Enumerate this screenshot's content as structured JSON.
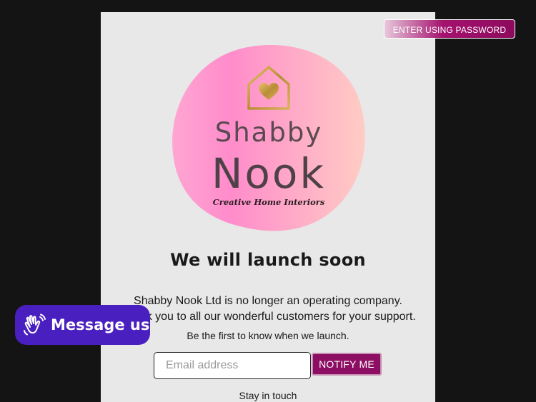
{
  "header": {
    "password_button_label": "ENTER USING PASSWORD"
  },
  "logo": {
    "brand_line1": "Shabby",
    "brand_line2": "Nook",
    "tagline": "Creative Home Interiors"
  },
  "main": {
    "headline": "We will launch soon",
    "notice_line1": "Shabby Nook Ltd is no longer an operating company.",
    "notice_line2": "Thank you to all our wonderful customers for your support.",
    "signup_prompt": "Be the first to know when we launch.",
    "email_placeholder": "Email address",
    "email_value": "",
    "notify_label": "NOTIFY ME",
    "stay_in_touch": "Stay in touch"
  },
  "chat_widget": {
    "label": "Message us",
    "icon": "waving-hand-icon"
  },
  "colors": {
    "background": "#141414",
    "panel": "#e8e8e8",
    "accent_magenta": "#8c0f63",
    "chat_purple": "#4a1fbf",
    "logo_pink": "#ff8ccb",
    "logo_peach": "#ffc8c0",
    "logo_gold": "#c9a24a"
  }
}
